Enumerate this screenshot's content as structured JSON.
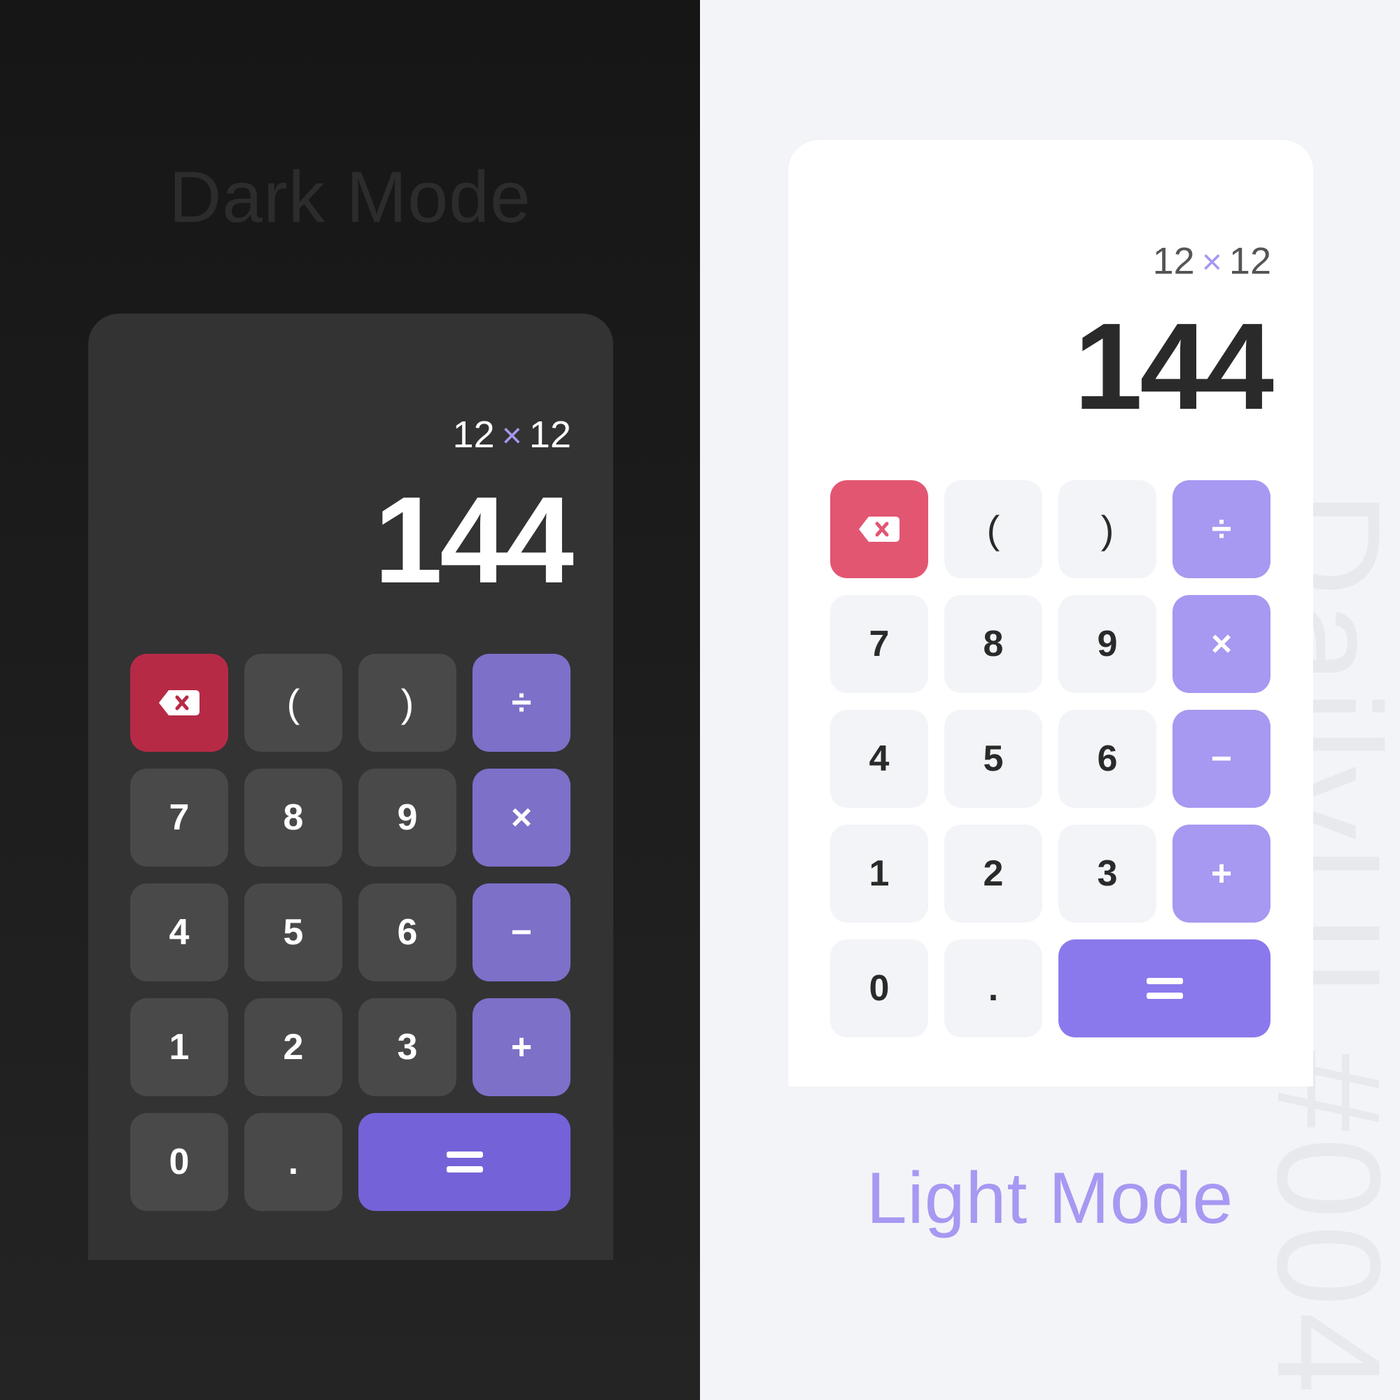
{
  "dark": {
    "heading": "Dark Mode",
    "expression": {
      "left": "12",
      "operator": "×",
      "right": "12"
    },
    "result": "144",
    "keys": {
      "open_paren": "(",
      "close_paren": ")",
      "divide": "÷",
      "multiply": "×",
      "minus": "−",
      "plus": "+",
      "equals": "=",
      "digits": [
        "7",
        "8",
        "9",
        "4",
        "5",
        "6",
        "1",
        "2",
        "3",
        "0"
      ],
      "dot": "."
    },
    "colors": {
      "background": "#1c1c1c",
      "card": "#333333",
      "number_key": "#494949",
      "operator_key": "#7c70c9",
      "delete_key": "#b72a46",
      "equals_key": "#7462d8"
    }
  },
  "light": {
    "heading": "Light Mode",
    "expression": {
      "left": "12",
      "operator": "×",
      "right": "12"
    },
    "result": "144",
    "keys": {
      "open_paren": "(",
      "close_paren": ")",
      "divide": "÷",
      "multiply": "×",
      "minus": "−",
      "plus": "+",
      "equals": "=",
      "digits": [
        "7",
        "8",
        "9",
        "4",
        "5",
        "6",
        "1",
        "2",
        "3",
        "0"
      ],
      "dot": "."
    },
    "colors": {
      "background": "#f3f4f8",
      "card": "#ffffff",
      "number_key": "#f3f4f7",
      "operator_key": "#a798f1",
      "delete_key": "#e25672",
      "equals_key": "#8a79ec"
    }
  },
  "watermark": "DailyUI #004",
  "icons": {
    "delete": "backspace-icon",
    "equals": "equals-icon"
  }
}
